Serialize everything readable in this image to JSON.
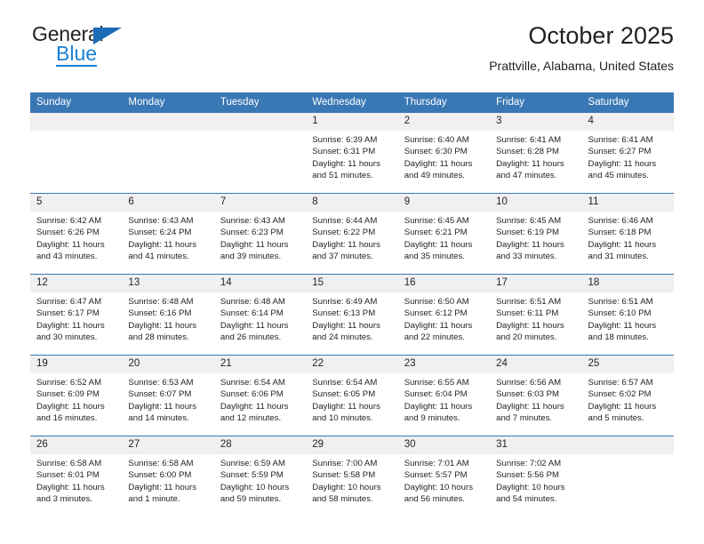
{
  "brand": {
    "name_part1": "General",
    "name_part2": "Blue",
    "triangle_color": "#1b6cb5",
    "blue_color": "#1b7fd4"
  },
  "header": {
    "title": "October 2025",
    "subtitle": "Prattville, Alabama, United States",
    "header_bg": "#3a77b5",
    "daynum_bg": "#f0f0f0"
  },
  "weekdays": [
    "Sunday",
    "Monday",
    "Tuesday",
    "Wednesday",
    "Thursday",
    "Friday",
    "Saturday"
  ],
  "labels": {
    "sunrise": "Sunrise:",
    "sunset": "Sunset:",
    "daylight": "Daylight:"
  },
  "weeks": [
    [
      {
        "day": "",
        "empty": true
      },
      {
        "day": "",
        "empty": true
      },
      {
        "day": "",
        "empty": true
      },
      {
        "day": "1",
        "sunrise": "Sunrise: 6:39 AM",
        "sunset": "Sunset: 6:31 PM",
        "daylight_line1": "Daylight: 11 hours",
        "daylight_line2": "and 51 minutes."
      },
      {
        "day": "2",
        "sunrise": "Sunrise: 6:40 AM",
        "sunset": "Sunset: 6:30 PM",
        "daylight_line1": "Daylight: 11 hours",
        "daylight_line2": "and 49 minutes."
      },
      {
        "day": "3",
        "sunrise": "Sunrise: 6:41 AM",
        "sunset": "Sunset: 6:28 PM",
        "daylight_line1": "Daylight: 11 hours",
        "daylight_line2": "and 47 minutes."
      },
      {
        "day": "4",
        "sunrise": "Sunrise: 6:41 AM",
        "sunset": "Sunset: 6:27 PM",
        "daylight_line1": "Daylight: 11 hours",
        "daylight_line2": "and 45 minutes."
      }
    ],
    [
      {
        "day": "5",
        "sunrise": "Sunrise: 6:42 AM",
        "sunset": "Sunset: 6:26 PM",
        "daylight_line1": "Daylight: 11 hours",
        "daylight_line2": "and 43 minutes."
      },
      {
        "day": "6",
        "sunrise": "Sunrise: 6:43 AM",
        "sunset": "Sunset: 6:24 PM",
        "daylight_line1": "Daylight: 11 hours",
        "daylight_line2": "and 41 minutes."
      },
      {
        "day": "7",
        "sunrise": "Sunrise: 6:43 AM",
        "sunset": "Sunset: 6:23 PM",
        "daylight_line1": "Daylight: 11 hours",
        "daylight_line2": "and 39 minutes."
      },
      {
        "day": "8",
        "sunrise": "Sunrise: 6:44 AM",
        "sunset": "Sunset: 6:22 PM",
        "daylight_line1": "Daylight: 11 hours",
        "daylight_line2": "and 37 minutes."
      },
      {
        "day": "9",
        "sunrise": "Sunrise: 6:45 AM",
        "sunset": "Sunset: 6:21 PM",
        "daylight_line1": "Daylight: 11 hours",
        "daylight_line2": "and 35 minutes."
      },
      {
        "day": "10",
        "sunrise": "Sunrise: 6:45 AM",
        "sunset": "Sunset: 6:19 PM",
        "daylight_line1": "Daylight: 11 hours",
        "daylight_line2": "and 33 minutes."
      },
      {
        "day": "11",
        "sunrise": "Sunrise: 6:46 AM",
        "sunset": "Sunset: 6:18 PM",
        "daylight_line1": "Daylight: 11 hours",
        "daylight_line2": "and 31 minutes."
      }
    ],
    [
      {
        "day": "12",
        "sunrise": "Sunrise: 6:47 AM",
        "sunset": "Sunset: 6:17 PM",
        "daylight_line1": "Daylight: 11 hours",
        "daylight_line2": "and 30 minutes."
      },
      {
        "day": "13",
        "sunrise": "Sunrise: 6:48 AM",
        "sunset": "Sunset: 6:16 PM",
        "daylight_line1": "Daylight: 11 hours",
        "daylight_line2": "and 28 minutes."
      },
      {
        "day": "14",
        "sunrise": "Sunrise: 6:48 AM",
        "sunset": "Sunset: 6:14 PM",
        "daylight_line1": "Daylight: 11 hours",
        "daylight_line2": "and 26 minutes."
      },
      {
        "day": "15",
        "sunrise": "Sunrise: 6:49 AM",
        "sunset": "Sunset: 6:13 PM",
        "daylight_line1": "Daylight: 11 hours",
        "daylight_line2": "and 24 minutes."
      },
      {
        "day": "16",
        "sunrise": "Sunrise: 6:50 AM",
        "sunset": "Sunset: 6:12 PM",
        "daylight_line1": "Daylight: 11 hours",
        "daylight_line2": "and 22 minutes."
      },
      {
        "day": "17",
        "sunrise": "Sunrise: 6:51 AM",
        "sunset": "Sunset: 6:11 PM",
        "daylight_line1": "Daylight: 11 hours",
        "daylight_line2": "and 20 minutes."
      },
      {
        "day": "18",
        "sunrise": "Sunrise: 6:51 AM",
        "sunset": "Sunset: 6:10 PM",
        "daylight_line1": "Daylight: 11 hours",
        "daylight_line2": "and 18 minutes."
      }
    ],
    [
      {
        "day": "19",
        "sunrise": "Sunrise: 6:52 AM",
        "sunset": "Sunset: 6:09 PM",
        "daylight_line1": "Daylight: 11 hours",
        "daylight_line2": "and 16 minutes."
      },
      {
        "day": "20",
        "sunrise": "Sunrise: 6:53 AM",
        "sunset": "Sunset: 6:07 PM",
        "daylight_line1": "Daylight: 11 hours",
        "daylight_line2": "and 14 minutes."
      },
      {
        "day": "21",
        "sunrise": "Sunrise: 6:54 AM",
        "sunset": "Sunset: 6:06 PM",
        "daylight_line1": "Daylight: 11 hours",
        "daylight_line2": "and 12 minutes."
      },
      {
        "day": "22",
        "sunrise": "Sunrise: 6:54 AM",
        "sunset": "Sunset: 6:05 PM",
        "daylight_line1": "Daylight: 11 hours",
        "daylight_line2": "and 10 minutes."
      },
      {
        "day": "23",
        "sunrise": "Sunrise: 6:55 AM",
        "sunset": "Sunset: 6:04 PM",
        "daylight_line1": "Daylight: 11 hours",
        "daylight_line2": "and 9 minutes."
      },
      {
        "day": "24",
        "sunrise": "Sunrise: 6:56 AM",
        "sunset": "Sunset: 6:03 PM",
        "daylight_line1": "Daylight: 11 hours",
        "daylight_line2": "and 7 minutes."
      },
      {
        "day": "25",
        "sunrise": "Sunrise: 6:57 AM",
        "sunset": "Sunset: 6:02 PM",
        "daylight_line1": "Daylight: 11 hours",
        "daylight_line2": "and 5 minutes."
      }
    ],
    [
      {
        "day": "26",
        "sunrise": "Sunrise: 6:58 AM",
        "sunset": "Sunset: 6:01 PM",
        "daylight_line1": "Daylight: 11 hours",
        "daylight_line2": "and 3 minutes."
      },
      {
        "day": "27",
        "sunrise": "Sunrise: 6:58 AM",
        "sunset": "Sunset: 6:00 PM",
        "daylight_line1": "Daylight: 11 hours",
        "daylight_line2": "and 1 minute."
      },
      {
        "day": "28",
        "sunrise": "Sunrise: 6:59 AM",
        "sunset": "Sunset: 5:59 PM",
        "daylight_line1": "Daylight: 10 hours",
        "daylight_line2": "and 59 minutes."
      },
      {
        "day": "29",
        "sunrise": "Sunrise: 7:00 AM",
        "sunset": "Sunset: 5:58 PM",
        "daylight_line1": "Daylight: 10 hours",
        "daylight_line2": "and 58 minutes."
      },
      {
        "day": "30",
        "sunrise": "Sunrise: 7:01 AM",
        "sunset": "Sunset: 5:57 PM",
        "daylight_line1": "Daylight: 10 hours",
        "daylight_line2": "and 56 minutes."
      },
      {
        "day": "31",
        "sunrise": "Sunrise: 7:02 AM",
        "sunset": "Sunset: 5:56 PM",
        "daylight_line1": "Daylight: 10 hours",
        "daylight_line2": "and 54 minutes."
      },
      {
        "day": "",
        "empty": true
      }
    ]
  ]
}
